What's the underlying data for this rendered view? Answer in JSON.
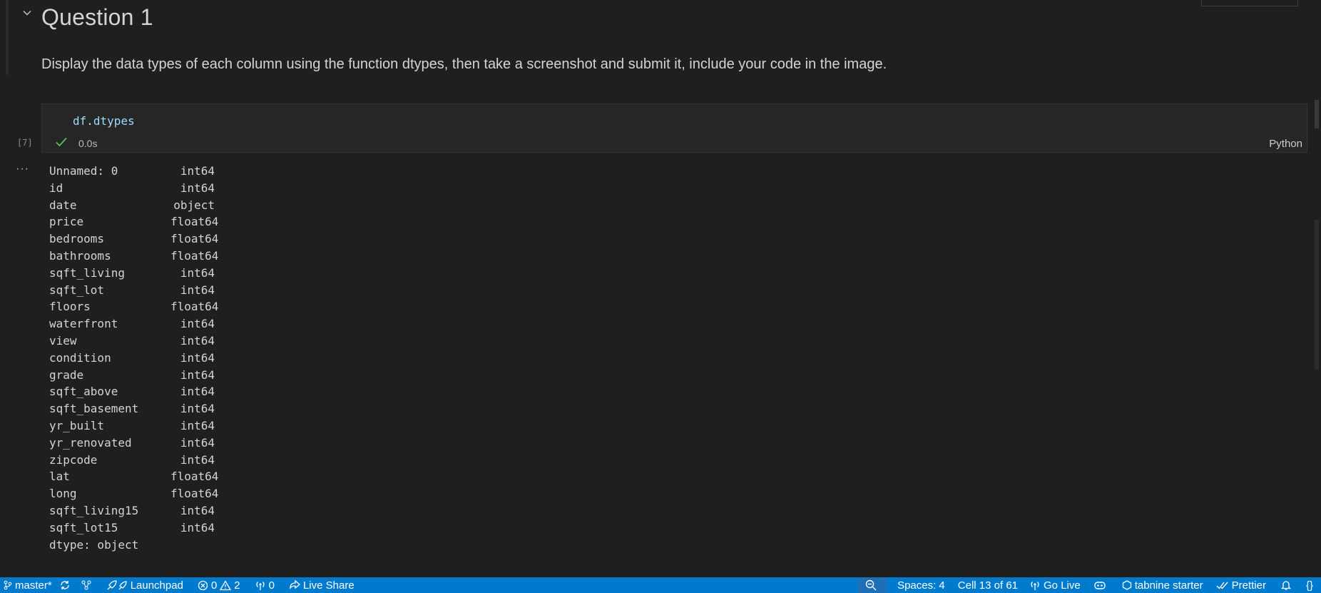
{
  "markdown": {
    "heading": "Question 1",
    "paragraph": "Display the data types of each column using the function dtypes, then take a screenshot and submit it, include your code in the image."
  },
  "code_cell": {
    "var": "df",
    "dot": ".",
    "attr": "dtypes",
    "exec_count": "[7]",
    "exec_time": "0.0s",
    "language": "Python",
    "status_icon": "check-icon"
  },
  "output": {
    "more_label": "···",
    "rows": [
      {
        "name": "Unnamed: 0",
        "type": "int64"
      },
      {
        "name": "id",
        "type": "int64"
      },
      {
        "name": "date",
        "type": "object"
      },
      {
        "name": "price",
        "type": "float64"
      },
      {
        "name": "bedrooms",
        "type": "float64"
      },
      {
        "name": "bathrooms",
        "type": "float64"
      },
      {
        "name": "sqft_living",
        "type": "int64"
      },
      {
        "name": "sqft_lot",
        "type": "int64"
      },
      {
        "name": "floors",
        "type": "float64"
      },
      {
        "name": "waterfront",
        "type": "int64"
      },
      {
        "name": "view",
        "type": "int64"
      },
      {
        "name": "condition",
        "type": "int64"
      },
      {
        "name": "grade",
        "type": "int64"
      },
      {
        "name": "sqft_above",
        "type": "int64"
      },
      {
        "name": "sqft_basement",
        "type": "int64"
      },
      {
        "name": "yr_built",
        "type": "int64"
      },
      {
        "name": "yr_renovated",
        "type": "int64"
      },
      {
        "name": "zipcode",
        "type": "int64"
      },
      {
        "name": "lat",
        "type": "float64"
      },
      {
        "name": "long",
        "type": "float64"
      },
      {
        "name": "sqft_living15",
        "type": "int64"
      },
      {
        "name": "sqft_lot15",
        "type": "int64"
      }
    ],
    "footer": "dtype: object"
  },
  "status_bar": {
    "branch": "master*",
    "launchpad": "Launchpad",
    "errors": "0",
    "warnings": "2",
    "ports": "0",
    "live_share": "Live Share",
    "spaces": "Spaces: 4",
    "cell_position": "Cell 13 of 61",
    "go_live": "Go Live",
    "tabnine": "tabnine starter",
    "prettier": "Prettier",
    "braces": "{}"
  },
  "colors": {
    "background": "#1f1f1f",
    "status_bar": "#007acc",
    "success_check": "#4ec94e",
    "code_variable": "#9cdcfe"
  }
}
